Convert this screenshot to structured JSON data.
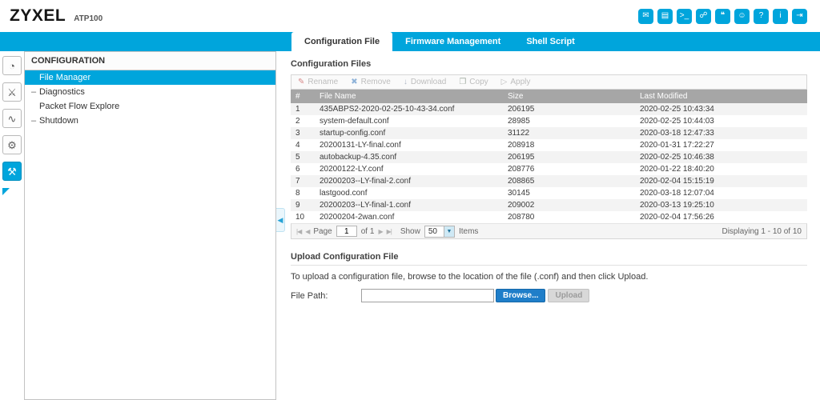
{
  "theme": {
    "accent_cyan": "#00a5dc",
    "table_header_gray": "#a6a6a6",
    "browse_button_blue": "#1f7ec9"
  },
  "header": {
    "brand": "ZYXEL",
    "model": "ATP100",
    "icons": [
      {
        "name": "message-icon",
        "glyph": "✉"
      },
      {
        "name": "web-console-icon",
        "glyph": "▤"
      },
      {
        "name": "cli-icon",
        "glyph": ">_"
      },
      {
        "name": "site-map-icon",
        "glyph": "☍"
      },
      {
        "name": "forum-icon",
        "glyph": "❝"
      },
      {
        "name": "community-icon",
        "glyph": "☺"
      },
      {
        "name": "help-icon",
        "glyph": "?"
      },
      {
        "name": "about-icon",
        "glyph": "i"
      },
      {
        "name": "logout-icon",
        "glyph": "⇥"
      }
    ]
  },
  "tabs": [
    {
      "name": "tab-configuration-file",
      "label": "Configuration File",
      "active": true
    },
    {
      "name": "tab-firmware-management",
      "label": "Firmware Management",
      "active": false
    },
    {
      "name": "tab-shell-script",
      "label": "Shell Script",
      "active": false
    }
  ],
  "rail": {
    "items": [
      {
        "name": "dashboard-icon",
        "glyph": "◔",
        "active": false
      },
      {
        "name": "security-service-icon",
        "glyph": "⚔",
        "active": false
      },
      {
        "name": "monitor-icon",
        "glyph": "∿",
        "active": false
      },
      {
        "name": "configuration-icon",
        "glyph": "⚙",
        "active": false
      },
      {
        "name": "maintenance-icon",
        "glyph": "⚒",
        "active": true
      }
    ]
  },
  "sidebar": {
    "section_title": "CONFIGURATION",
    "collapse_glyph": "◀",
    "items": [
      {
        "name": "sidebar-item-file-manager",
        "label": "File Manager",
        "bullet": "",
        "active": true
      },
      {
        "name": "sidebar-item-diagnostics",
        "label": "Diagnostics",
        "bullet": "–",
        "active": false
      },
      {
        "name": "sidebar-item-packet-flow-explore",
        "label": "Packet Flow Explore",
        "bullet": "",
        "active": false
      },
      {
        "name": "sidebar-item-shutdown",
        "label": "Shutdown",
        "bullet": "–",
        "active": false
      }
    ]
  },
  "config_files": {
    "section_title": "Configuration Files",
    "toolbar": [
      {
        "name": "rename-button",
        "label": "Rename",
        "glyph": "✎"
      },
      {
        "name": "remove-button",
        "label": "Remove",
        "glyph": "✖"
      },
      {
        "name": "download-button",
        "label": "Download",
        "glyph": "↓"
      },
      {
        "name": "copy-button",
        "label": "Copy",
        "glyph": "❐"
      },
      {
        "name": "apply-button",
        "label": "Apply",
        "glyph": "▷"
      }
    ],
    "table": {
      "headers": [
        "#",
        "File Name",
        "Size",
        "Last Modified"
      ],
      "rows": [
        {
          "num": "1",
          "name": "435ABPS2-2020-02-25-10-43-34.conf",
          "size": "206195",
          "modified": "2020-02-25 10:43:34"
        },
        {
          "num": "2",
          "name": "system-default.conf",
          "size": "28985",
          "modified": "2020-02-25 10:44:03"
        },
        {
          "num": "3",
          "name": "startup-config.conf",
          "size": "31122",
          "modified": "2020-03-18 12:47:33"
        },
        {
          "num": "4",
          "name": "20200131-LY-final.conf",
          "size": "208918",
          "modified": "2020-01-31 17:22:27"
        },
        {
          "num": "5",
          "name": "autobackup-4.35.conf",
          "size": "206195",
          "modified": "2020-02-25 10:46:38"
        },
        {
          "num": "6",
          "name": "20200122-LY.conf",
          "size": "208776",
          "modified": "2020-01-22 18:40:20"
        },
        {
          "num": "7",
          "name": "20200203--LY-final-2.conf",
          "size": "208865",
          "modified": "2020-02-04 15:15:19"
        },
        {
          "num": "8",
          "name": "lastgood.conf",
          "size": "30145",
          "modified": "2020-03-18 12:07:04"
        },
        {
          "num": "9",
          "name": "20200203--LY-final-1.conf",
          "size": "209002",
          "modified": "2020-03-13 19:25:10"
        },
        {
          "num": "10",
          "name": "20200204-2wan.conf",
          "size": "208780",
          "modified": "2020-02-04 17:56:26"
        }
      ]
    },
    "pagination": {
      "first": "|◀",
      "prev": "◀",
      "page_label": "Page",
      "page_value": "1",
      "of_label": "of 1",
      "next": "▶",
      "last": "▶|",
      "show_label": "Show",
      "page_size": "50",
      "dropdown_glyph": "▼",
      "items_label": "Items",
      "displaying": "Displaying 1 - 10 of 10"
    }
  },
  "upload": {
    "section_title": "Upload Configuration File",
    "instructions": "To upload a configuration file, browse to the location of the file (.conf) and then click Upload.",
    "file_path_label": "File Path:",
    "file_path_value": "",
    "browse_label": "Browse...",
    "upload_label": "Upload"
  }
}
